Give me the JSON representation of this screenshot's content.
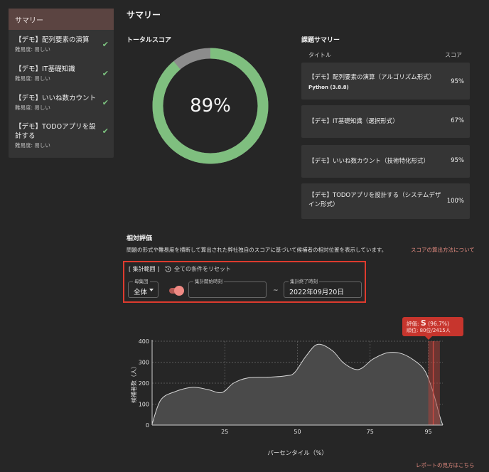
{
  "sidebar": {
    "header": "サマリー",
    "items": [
      {
        "title": "【デモ】配列要素の演算",
        "difficulty": "難易度: 易しい",
        "done": "✔"
      },
      {
        "title": "【デモ】IT基礎知識",
        "difficulty": "難易度: 易しい",
        "done": "✔"
      },
      {
        "title": "【デモ】いいね数カウント",
        "difficulty": "難易度: 易しい",
        "done": "✔"
      },
      {
        "title": "【デモ】TODOアプリを設計する",
        "difficulty": "難易度: 易しい",
        "done": "✔"
      }
    ]
  },
  "summary": {
    "title": "サマリー",
    "total_score_label": "トータルスコア",
    "total_score_value": "89%",
    "total_score_fraction": 0.89,
    "tasks_title": "課題サマリー",
    "col_title": "タイトル",
    "col_score": "スコア",
    "tasks": [
      {
        "name": "【デモ】配列要素の演算（アルゴリズム形式）",
        "lang": "Python (3.8.8)",
        "score": "95%"
      },
      {
        "name": "【デモ】IT基礎知識（選択形式）",
        "score": "67%"
      },
      {
        "name": "【デモ】いいね数カウント（技術特化形式）",
        "score": "95%"
      },
      {
        "name": "【デモ】TODOアプリを設計する（システムデザイン形式）",
        "score": "100%"
      }
    ]
  },
  "relative": {
    "title": "相対評価",
    "description": "問題の形式や難易度を横断して算出された弊社独自のスコアに基づいて候補者の相対位置を表示しています。",
    "score_method_link": "スコアの算出方法について",
    "range_label": "[ 集計範囲 ]",
    "reset_label": "全ての条件をリセット",
    "population_legend": "母集団",
    "population_value": "全体",
    "start_legend": "集計開始時刻",
    "start_value": "",
    "tilde": "~",
    "end_legend": "集計終了時刻",
    "end_value": "2022年09月20日",
    "report_link": "レポートの見方はこちら"
  },
  "tooltip": {
    "rating_prefix": "評価:",
    "grade": "S",
    "percent": "(96.7%)",
    "rank": "順位: 80位/2415人"
  },
  "colors": {
    "accent": "#dd3b2e",
    "donut_fill": "#7fbf7f",
    "donut_rest": "#8c8c8c",
    "check": "#7cc27f",
    "link": "#e48b80"
  },
  "chart_data": {
    "type": "area",
    "xlabel": "パーセンタイル（%）",
    "ylabel": "候補者数（人）",
    "xlim": [
      0,
      100
    ],
    "ylim": [
      0,
      400
    ],
    "x_ticks": [
      25,
      50,
      75,
      95
    ],
    "y_ticks": [
      0,
      100,
      200,
      300,
      400
    ],
    "grid": true,
    "x": [
      0,
      3,
      8,
      14,
      19,
      24,
      28,
      33,
      40,
      46,
      49,
      53,
      57,
      62,
      66,
      71,
      76,
      81,
      86,
      91,
      94,
      96.5,
      99,
      100
    ],
    "values": [
      5,
      120,
      160,
      180,
      170,
      155,
      200,
      225,
      228,
      235,
      250,
      330,
      385,
      355,
      295,
      265,
      315,
      345,
      340,
      300,
      255,
      165,
      40,
      0
    ],
    "marker": {
      "x": 96.7,
      "band": [
        95,
        99
      ]
    }
  }
}
